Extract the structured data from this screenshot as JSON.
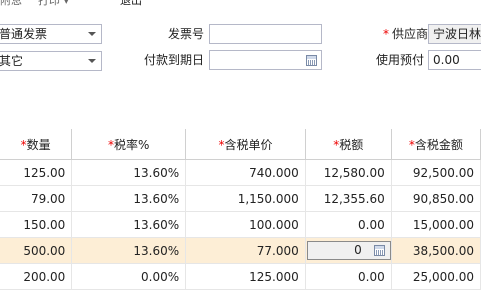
{
  "toolbar": {
    "item1": "附息",
    "item2": "打印 ▾",
    "item3": "退出"
  },
  "form": {
    "invoice_type_value": "普通发票",
    "other_value": "其它",
    "invoice_no_label": "发票号",
    "invoice_no_value": "",
    "due_date_label": "付款到期日",
    "due_date_value": "",
    "supplier_required": "*",
    "supplier_label": "供应商",
    "supplier_value": "宁波日林",
    "prepay_label": "使用预付",
    "prepay_value": "0.00"
  },
  "table": {
    "columns": [
      {
        "req": "*",
        "label": "数量"
      },
      {
        "req": "*",
        "label": "税率%"
      },
      {
        "req": "*",
        "label": "含税单价"
      },
      {
        "req": "*",
        "label": "税额"
      },
      {
        "req": "*",
        "label": "含税金额"
      }
    ],
    "rows": [
      {
        "qty": "125.00",
        "rate": "13.60%",
        "price": "740.000",
        "tax": "12,580.00",
        "amount": "92,500.00"
      },
      {
        "qty": "79.00",
        "rate": "13.60%",
        "price": "1,150.000",
        "tax": "12,355.60",
        "amount": "90,850.00"
      },
      {
        "qty": "150.00",
        "rate": "13.60%",
        "price": "100.000",
        "tax": "0.00",
        "amount": "15,000.00"
      },
      {
        "qty": "500.00",
        "rate": "13.60%",
        "price": "77.000",
        "tax": "0",
        "amount": "38,500.00"
      },
      {
        "qty": "200.00",
        "rate": "0.00%",
        "price": "125.000",
        "tax": "0.00",
        "amount": "25,000.00"
      }
    ]
  }
}
